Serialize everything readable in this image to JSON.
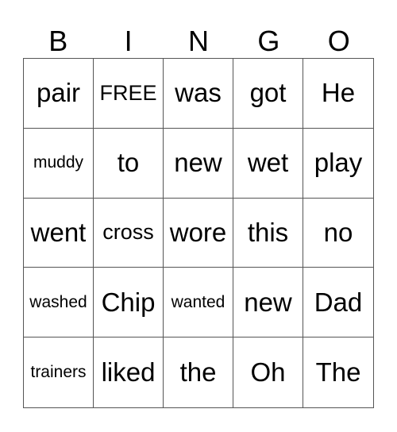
{
  "header": {
    "letters": [
      "B",
      "I",
      "N",
      "G",
      "O"
    ]
  },
  "grid": {
    "rows": [
      [
        {
          "text": "pair",
          "size": "l"
        },
        {
          "text": "FREE",
          "size": "m"
        },
        {
          "text": "was",
          "size": "l"
        },
        {
          "text": "got",
          "size": "l"
        },
        {
          "text": "He",
          "size": "l"
        }
      ],
      [
        {
          "text": "muddy",
          "size": "xs"
        },
        {
          "text": "to",
          "size": "l"
        },
        {
          "text": "new",
          "size": "l"
        },
        {
          "text": "wet",
          "size": "l"
        },
        {
          "text": "play",
          "size": "l"
        }
      ],
      [
        {
          "text": "went",
          "size": "l"
        },
        {
          "text": "cross",
          "size": "m"
        },
        {
          "text": "wore",
          "size": "l"
        },
        {
          "text": "this",
          "size": "l"
        },
        {
          "text": "no",
          "size": "l"
        }
      ],
      [
        {
          "text": "washed",
          "size": "xs"
        },
        {
          "text": "Chip",
          "size": "l"
        },
        {
          "text": "wanted",
          "size": "xs"
        },
        {
          "text": "new",
          "size": "l"
        },
        {
          "text": "Dad",
          "size": "l"
        }
      ],
      [
        {
          "text": "trainers",
          "size": "xs"
        },
        {
          "text": "liked",
          "size": "l"
        },
        {
          "text": "the",
          "size": "l"
        },
        {
          "text": "Oh",
          "size": "l"
        },
        {
          "text": "The",
          "size": "l"
        }
      ]
    ]
  }
}
